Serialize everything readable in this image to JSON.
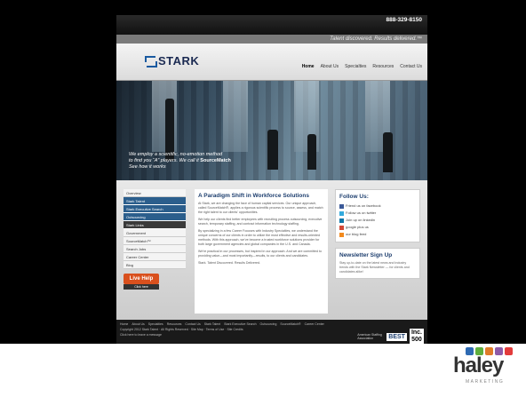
{
  "header": {
    "phone": "888-329-8150",
    "tagline": "Talent discovered. Results delivered.™",
    "logo_text": "STARK"
  },
  "nav": [
    "Home",
    "About Us",
    "Specialties",
    "Resources",
    "Contact Us"
  ],
  "hero": {
    "caption_line1": "We employ a scientific, no-emotion method",
    "caption_line2": "to find you “A” players. We call it",
    "caption_brand": "SourceMatch",
    "caption_line3": "See how it works"
  },
  "leftnav": {
    "items": [
      {
        "label": "Overview",
        "style": "light"
      },
      {
        "label": "Stark Talent",
        "style": "blue"
      },
      {
        "label": "Stark Executive Search",
        "style": "blue"
      },
      {
        "label": "Outsourcing",
        "style": "blue"
      },
      {
        "label": "Stark Links",
        "style": "dark"
      },
      {
        "label": "Government",
        "style": "light"
      },
      {
        "label": "SourceMatch™",
        "style": "light"
      },
      {
        "label": "Search Jobs",
        "style": "light"
      },
      {
        "label": "Career Center",
        "style": "light"
      },
      {
        "label": "Blog",
        "style": "light"
      }
    ],
    "help_label": "Live Help",
    "chat_label": "Click here"
  },
  "article": {
    "title": "A Paradigm Shift in Workforce Solutions",
    "p1": "At Stark, we are changing the face of human capital services. Our unique approach, called SourceMatch®, applies a rigorous scientific process to source, assess, and match the right talent to our clients' opportunities.",
    "p2": "We help our clients find better employees with recruiting process outsourcing, executive search, temporary staffing, and contract information technology staffing.",
    "p3": "By specializing in a few Career Focuses with Industry Specialties, we understand the unique concerns of our clients in order to utilize the most effective and results-oriented methods. With this approach, we've become a trusted workforce solutions provider for both large government agencies and global companies in the U.S. and Canada.",
    "p4": "We're practical in our processes, but inspired in our approach. And we are committed to providing value—and most importantly—results, to our clients and candidates.",
    "p5": "Stark. Talent Discovered. Results Delivered."
  },
  "follow": {
    "title": "Follow Us:",
    "items": [
      "Friend us on facebook",
      "Follow us on twitter",
      "Join up on linkedin",
      "google plus us",
      "our blog feed"
    ]
  },
  "newsletter": {
    "title": "Newsletter Sign Up",
    "text": "Stay up-to-date on the latest news and industry trends with the Stark Newsletter — for clients and candidates alike!"
  },
  "footer": {
    "links": [
      "Home",
      "About Us",
      "Specialties",
      "Resources",
      "Contact Us",
      "Stark Talent",
      "Stark Executive Search",
      "Outsourcing",
      "SourceMatch®",
      "Career Center"
    ],
    "copyright": "Copyright 2012 Stark Talent · All Rights Reserved · Site Map · Terms of Use · Site Credits",
    "bottom": "Click here to leave a message",
    "badge_asa": "American Staffing Association",
    "badge_best": "BEST",
    "badge_inc_top": "Inc.",
    "badge_inc_bottom": "500"
  },
  "haley": {
    "word": "haley",
    "sub": "MARKETING",
    "colors": [
      "#2e6ab3",
      "#5fae3c",
      "#e07b2a",
      "#8e5aa8",
      "#e23b3b"
    ]
  }
}
